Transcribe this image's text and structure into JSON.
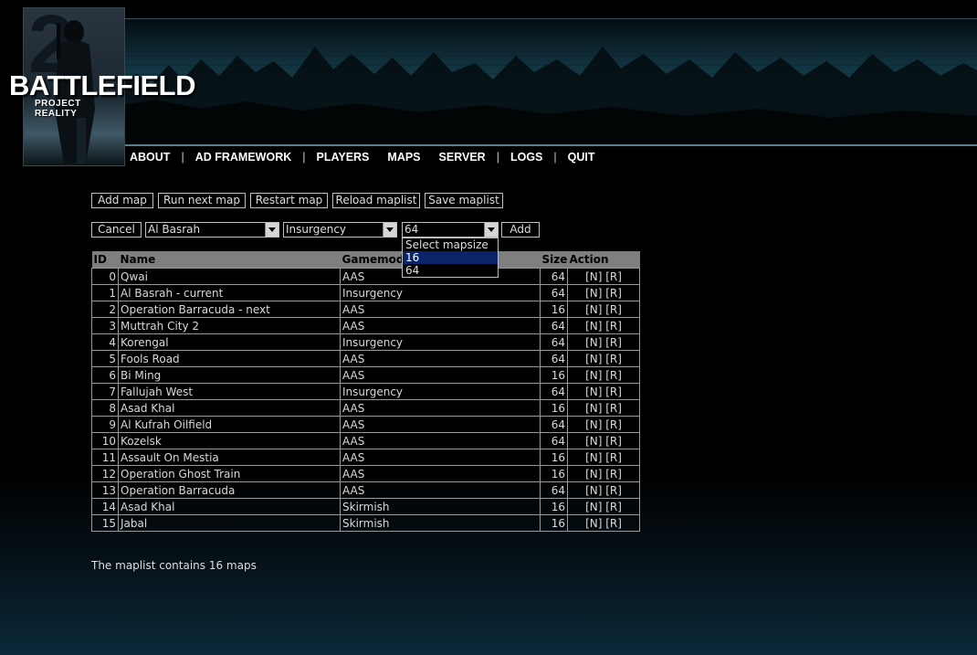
{
  "logo": {
    "title": "BATTLEFIELD",
    "subtitle": "PROJECT REALITY",
    "emblem": "2"
  },
  "nav": [
    "ABOUT",
    "AD FRAMEWORK",
    "PLAYERS",
    "MAPS",
    "SERVER",
    "LOGS",
    "QUIT"
  ],
  "toolbar": {
    "add_map": "Add map",
    "run_next_map": "Run next map",
    "restart_map": "Restart map",
    "reload_maplist": "Reload maplist",
    "save_maplist": "Save maplist"
  },
  "form": {
    "cancel": "Cancel",
    "map_value": "Al Basrah",
    "gamemode_value": "Insurgency",
    "size_value": "64",
    "add": "Add",
    "size_options": [
      {
        "label": "Select mapsize",
        "highlighted": false
      },
      {
        "label": "16",
        "highlighted": true
      },
      {
        "label": "64",
        "highlighted": false
      }
    ]
  },
  "table": {
    "headers": {
      "id": "ID",
      "name": "Name",
      "gamemode": "Gamemode",
      "size": "Size",
      "action": "Action"
    },
    "action_new": "[N]",
    "action_remove": "[R]",
    "rows": [
      {
        "id": "0",
        "name": "Qwai",
        "gamemode": "AAS",
        "size": "64"
      },
      {
        "id": "1",
        "name": "Al Basrah - current",
        "gamemode": "Insurgency",
        "size": "64"
      },
      {
        "id": "2",
        "name": "Operation Barracuda - next",
        "gamemode": "AAS",
        "size": "16"
      },
      {
        "id": "3",
        "name": "Muttrah City 2",
        "gamemode": "AAS",
        "size": "64"
      },
      {
        "id": "4",
        "name": "Korengal",
        "gamemode": "Insurgency",
        "size": "64"
      },
      {
        "id": "5",
        "name": "Fools Road",
        "gamemode": "AAS",
        "size": "64"
      },
      {
        "id": "6",
        "name": "Bi Ming",
        "gamemode": "AAS",
        "size": "16"
      },
      {
        "id": "7",
        "name": "Fallujah West",
        "gamemode": "Insurgency",
        "size": "64"
      },
      {
        "id": "8",
        "name": "Asad Khal",
        "gamemode": "AAS",
        "size": "16"
      },
      {
        "id": "9",
        "name": "Al Kufrah Oilfield",
        "gamemode": "AAS",
        "size": "64"
      },
      {
        "id": "10",
        "name": "Kozelsk",
        "gamemode": "AAS",
        "size": "64"
      },
      {
        "id": "11",
        "name": "Assault On Mestia",
        "gamemode": "AAS",
        "size": "16"
      },
      {
        "id": "12",
        "name": "Operation Ghost Train",
        "gamemode": "AAS",
        "size": "16"
      },
      {
        "id": "13",
        "name": "Operation Barracuda",
        "gamemode": "AAS",
        "size": "64"
      },
      {
        "id": "14",
        "name": "Asad Khal",
        "gamemode": "Skirmish",
        "size": "16"
      },
      {
        "id": "15",
        "name": "Jabal",
        "gamemode": "Skirmish",
        "size": "16"
      }
    ]
  },
  "summary": "The maplist contains 16 maps",
  "colors": {
    "highlight": "#0a246a",
    "header_bg": "#7f7f7f",
    "border": "#9a9a9a",
    "nav_text": "#ffffff"
  }
}
